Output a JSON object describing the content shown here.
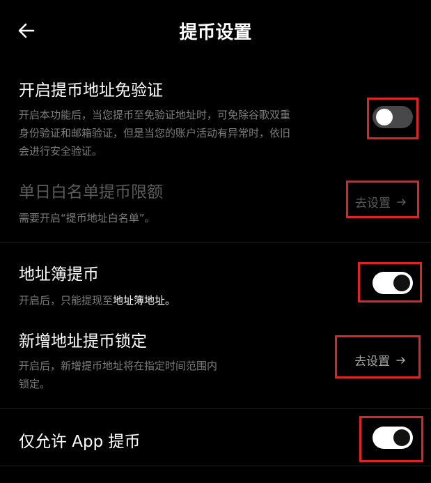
{
  "header": {
    "title": "提币设置"
  },
  "settings": {
    "no_verify": {
      "title": "开启提币地址免验证",
      "desc_line1": "开启本功能后，当您提币至免验证地址时，可免除谷歌双重",
      "desc_line2": "身份验证和邮箱验证，但是当您的账户活动有异常时，依旧",
      "desc_line3": "会进行安全验证。",
      "enabled": false
    },
    "daily_limit": {
      "title": "单日白名单提币限额",
      "desc": "需要开启“提币地址白名单”。",
      "action_label": "去设置"
    },
    "address_book": {
      "title": "地址簿提币",
      "desc_prefix": "开启后，只能提现至",
      "desc_highlight": "地址簿地址。",
      "enabled": true
    },
    "new_address_lock": {
      "title": "新增地址提币锁定",
      "desc_line1": "开启后，新增提币地址将在指定时间范围内",
      "desc_line2": "锁定。",
      "action_label": "去设置"
    },
    "app_only": {
      "title": "仅允许 App 提币",
      "enabled": true
    }
  },
  "colors": {
    "annotation": "#e02424",
    "toggle_off": "#48484a",
    "toggle_on": "#ffffff"
  }
}
